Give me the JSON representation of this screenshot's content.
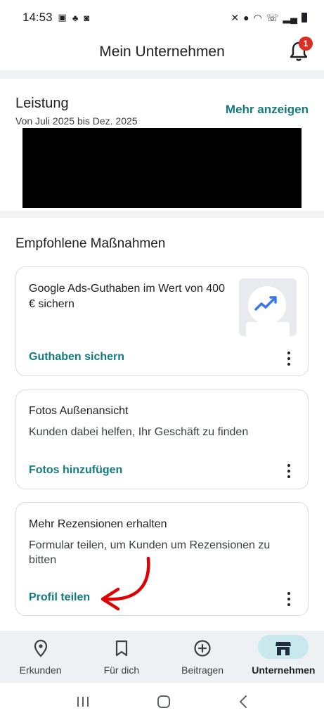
{
  "status_bar": {
    "time": "14:53"
  },
  "app_bar": {
    "title": "Mein Unternehmen",
    "notification_count": "1"
  },
  "performance": {
    "title": "Leistung",
    "subtitle": "Von Juli 2025 bis Dez. 2025",
    "more_link": "Mehr anzeigen"
  },
  "recommendations": {
    "title": "Empfohlene Maßnahmen",
    "cards": [
      {
        "title": "Google Ads-Guthaben im Wert von 400 € sichern",
        "description": "",
        "action": "Guthaben sichern"
      },
      {
        "title": "Fotos Außenansicht",
        "description": "Kunden dabei helfen, Ihr Geschäft zu finden",
        "action": "Fotos hinzufügen"
      },
      {
        "title": "Mehr Rezensionen erhalten",
        "description": "Formular teilen, um Kunden um Rezensionen zu bitten",
        "action": "Profil teilen"
      }
    ]
  },
  "bottom_nav": [
    {
      "label": "Erkunden",
      "icon": "location-pin-icon",
      "active": false
    },
    {
      "label": "Für dich",
      "icon": "bookmark-icon",
      "active": false
    },
    {
      "label": "Beitragen",
      "icon": "add-circle-icon",
      "active": false
    },
    {
      "label": "Unternehmen",
      "icon": "storefront-icon",
      "active": true
    }
  ],
  "colors": {
    "accent": "#137a7f",
    "badge": "#d93025",
    "nav_bg": "#eef1f4",
    "nav_active_pill": "#c8e8ee",
    "annotation_arrow": "#e00000"
  }
}
